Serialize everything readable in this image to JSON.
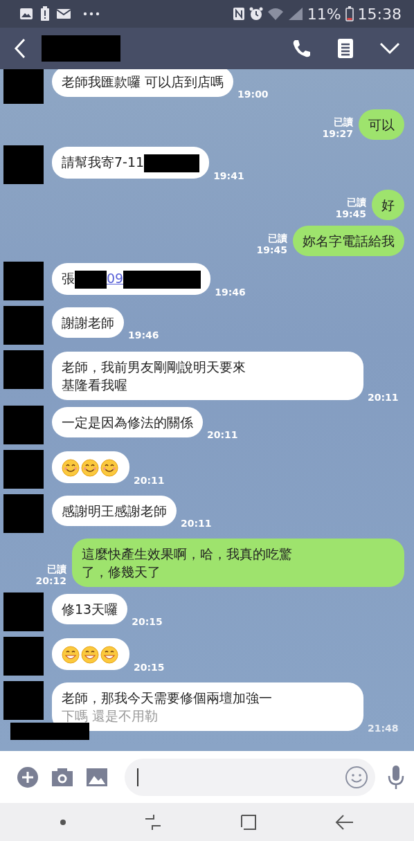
{
  "status_bar": {
    "battery": "11%",
    "time": "15:38"
  },
  "messages": [
    {
      "kind": "incoming",
      "parts": [
        {
          "kind": "text",
          "text": "老師我匯款囉 可以店到店嗎"
        }
      ],
      "time": "19:00"
    },
    {
      "kind": "outgoing",
      "parts": [
        {
          "kind": "text",
          "text": "可以"
        }
      ],
      "read": "已讀",
      "time": "19:27"
    },
    {
      "kind": "incoming",
      "parts": [
        {
          "kind": "text",
          "text": "請幫我寄7-11"
        },
        {
          "kind": "redacted"
        }
      ],
      "time": "19:41"
    },
    {
      "kind": "outgoing",
      "parts": [
        {
          "kind": "text",
          "text": "好"
        }
      ],
      "read": "已讀",
      "time": "19:45"
    },
    {
      "kind": "outgoing",
      "parts": [
        {
          "kind": "text",
          "text": "妳名字電話給我"
        }
      ],
      "read": "已讀",
      "time": "19:45"
    },
    {
      "kind": "incoming",
      "parts": [
        {
          "kind": "text",
          "text": "張"
        },
        {
          "kind": "redacted"
        },
        {
          "kind": "link",
          "text": "09"
        },
        {
          "kind": "redacted"
        }
      ],
      "time": "19:46"
    },
    {
      "kind": "incoming",
      "parts": [
        {
          "kind": "text",
          "text": "謝謝老師"
        }
      ],
      "time": "19:46"
    },
    {
      "kind": "incoming",
      "parts": [
        {
          "kind": "text",
          "text": "老師，我前男友剛剛說明天要來"
        },
        {
          "kind": "break"
        },
        {
          "kind": "text",
          "text": "基隆看我喔"
        }
      ],
      "time": "20:11"
    },
    {
      "kind": "incoming",
      "parts": [
        {
          "kind": "text",
          "text": "一定是因為修法的關係"
        }
      ],
      "time": "20:11"
    },
    {
      "kind": "incoming",
      "parts": [
        {
          "kind": "smile-emoji"
        },
        {
          "kind": "smile-emoji"
        },
        {
          "kind": "smile-emoji"
        }
      ],
      "time": "20:11"
    },
    {
      "kind": "incoming",
      "parts": [
        {
          "kind": "text",
          "text": "感謝明王感謝老師"
        }
      ],
      "time": "20:11"
    },
    {
      "kind": "outgoing",
      "parts": [
        {
          "kind": "text",
          "text": "這麼快產生效果啊，哈，我真的吃驚"
        },
        {
          "kind": "break"
        },
        {
          "kind": "text",
          "text": "了，修幾天了"
        }
      ],
      "read": "已讀",
      "time": "20:12"
    },
    {
      "kind": "incoming",
      "parts": [
        {
          "kind": "text",
          "text": "修13天囉"
        }
      ],
      "time": "20:15"
    },
    {
      "kind": "incoming",
      "parts": [
        {
          "kind": "grin-emoji"
        },
        {
          "kind": "grin-emoji"
        },
        {
          "kind": "grin-emoji"
        }
      ],
      "time": "20:15"
    },
    {
      "kind": "incoming",
      "parts": [
        {
          "kind": "text",
          "text": "老師，那我今天需要修個兩壇加強一"
        },
        {
          "kind": "break"
        },
        {
          "kind": "faded",
          "text": "下嗎 還是不用勒"
        }
      ],
      "time": "21:48"
    }
  ]
}
